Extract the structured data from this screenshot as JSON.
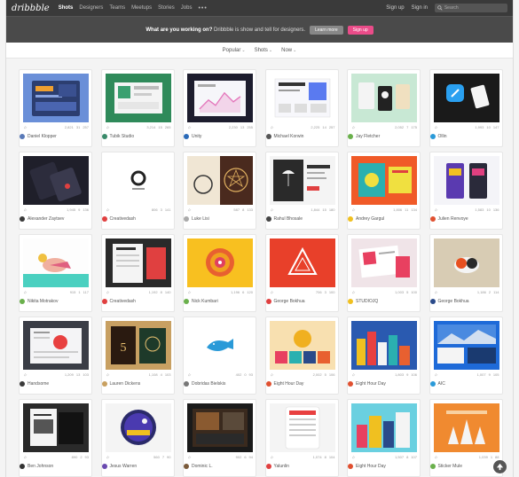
{
  "nav": {
    "logo": "dribbble",
    "links": [
      "Shots",
      "Designers",
      "Teams",
      "Meetups",
      "Stories",
      "Jobs"
    ],
    "more": "•••",
    "sign_up": "Sign up",
    "sign_in": "Sign in",
    "search_placeholder": "Search"
  },
  "banner": {
    "question": "What are you working on?",
    "text": " Dribbble is show and tell for designers.",
    "learn_more": "Learn more",
    "sign_up": "Sign up"
  },
  "filters": [
    "Popular",
    "Shots",
    "Now"
  ],
  "shots": [
    {
      "user": "Daniel Klopper",
      "views": "2,821",
      "comments": "31",
      "likes": "257",
      "avatar": "#5a7ab8"
    },
    {
      "user": "Tubik Studio",
      "views": "3,214",
      "comments": "15",
      "likes": "265",
      "avatar": "#3a8a6a"
    },
    {
      "user": "Unity",
      "views": "2,230",
      "comments": "13",
      "likes": "255",
      "avatar": "#2a6ab8"
    },
    {
      "user": "Michael Korwin",
      "views": "2,225",
      "comments": "14",
      "likes": "257",
      "avatar": "#555555"
    },
    {
      "user": "Jay Fletcher",
      "views": "2,052",
      "comments": "7",
      "likes": "175",
      "avatar": "#6ab04c"
    },
    {
      "user": "Ollin",
      "views": "1,993",
      "comments": "10",
      "likes": "147",
      "avatar": "#2a9ad8"
    },
    {
      "user": "Alexander Zaytsev",
      "views": "1,945",
      "comments": "9",
      "likes": "136",
      "avatar": "#3a3a3a"
    },
    {
      "user": "Creativedash",
      "views": "806",
      "comments": "3",
      "likes": "141",
      "avatar": "#e04040"
    },
    {
      "user": "Luke Lisi",
      "views": "587",
      "comments": "8",
      "likes": "133",
      "avatar": "#aaaaaa"
    },
    {
      "user": "Rahul Bhosale",
      "views": "1,844",
      "comments": "15",
      "likes": "180",
      "avatar": "#444444"
    },
    {
      "user": "Andrey Gargul",
      "views": "1,806",
      "comments": "11",
      "likes": "134",
      "avatar": "#f0c020"
    },
    {
      "user": "Julien Renvoye",
      "views": "1,583",
      "comments": "10",
      "likes": "136",
      "avatar": "#e05030"
    },
    {
      "user": "Nikita Motrakov",
      "views": "915",
      "comments": "1",
      "likes": "117",
      "avatar": "#6ab04c"
    },
    {
      "user": "Creativedash",
      "views": "1,192",
      "comments": "8",
      "likes": "140",
      "avatar": "#e04040"
    },
    {
      "user": "Nick Kumbari",
      "views": "1,196",
      "comments": "6",
      "likes": "120",
      "avatar": "#6ab04c"
    },
    {
      "user": "George Bokhua",
      "views": "706",
      "comments": "3",
      "likes": "100",
      "avatar": "#e04040"
    },
    {
      "user": "STUDIOJQ",
      "views": "1,003",
      "comments": "5",
      "likes": "100",
      "avatar": "#f0c020"
    },
    {
      "user": "George Bokhua",
      "views": "1,186",
      "comments": "2",
      "likes": "114",
      "avatar": "#2a4a8a"
    },
    {
      "user": "Handsome",
      "views": "1,209",
      "comments": "13",
      "likes": "103",
      "avatar": "#3a3a3a"
    },
    {
      "user": "Lauren Dickens",
      "views": "1,108",
      "comments": "4",
      "likes": "103",
      "avatar": "#c8a060"
    },
    {
      "user": "Dobridas Bielskis",
      "views": "402",
      "comments": "0",
      "likes": "93",
      "avatar": "#777777"
    },
    {
      "user": "Eight Hour Day",
      "views": "2,002",
      "comments": "5",
      "likes": "106",
      "avatar": "#e05030"
    },
    {
      "user": "Eight Hour Day",
      "views": "1,803",
      "comments": "9",
      "likes": "106",
      "avatar": "#e05030"
    },
    {
      "user": "AIC",
      "views": "1,007",
      "comments": "9",
      "likes": "105",
      "avatar": "#2a9ad8"
    },
    {
      "user": "Ben Johnson",
      "views": "890",
      "comments": "2",
      "likes": "93",
      "avatar": "#333333"
    },
    {
      "user": "Jesus Warren",
      "views": "560",
      "comments": "7",
      "likes": "90",
      "avatar": "#6a4ab0"
    },
    {
      "user": "Dominic L.",
      "views": "902",
      "comments": "6",
      "likes": "94",
      "avatar": "#7a5a3a"
    },
    {
      "user": "Yalunlin",
      "views": "1,074",
      "comments": "8",
      "likes": "104",
      "avatar": "#e04040"
    },
    {
      "user": "Eight Hour Day",
      "views": "1,507",
      "comments": "8",
      "likes": "107",
      "avatar": "#e05030"
    },
    {
      "user": "Sticker Mule",
      "views": "1,039",
      "comments": "1",
      "likes": "88",
      "avatar": "#6ab04c"
    }
  ]
}
